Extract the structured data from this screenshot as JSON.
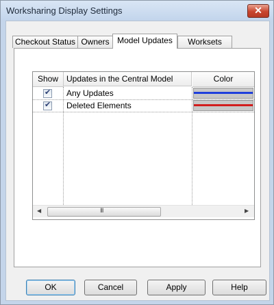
{
  "window": {
    "title": "Worksharing Display Settings",
    "close_glyph": "✕"
  },
  "tabs": [
    {
      "label": "Checkout Status",
      "active": false
    },
    {
      "label": "Owners",
      "active": false
    },
    {
      "label": "Model Updates",
      "active": true
    },
    {
      "label": "Worksets",
      "active": false
    }
  ],
  "grid": {
    "columns": {
      "show": "Show",
      "updates": "Updates in the Central Model",
      "color": "Color"
    },
    "rows": [
      {
        "checked": true,
        "label": "Any Updates",
        "color": "#1f3fdc"
      },
      {
        "checked": true,
        "label": "Deleted Elements",
        "color": "#d21d1d"
      }
    ]
  },
  "scrollbar": {
    "left_icon": "◀",
    "right_icon": "▶",
    "grip": "III"
  },
  "buttons": {
    "ok": "OK",
    "cancel": "Cancel",
    "apply": "Apply",
    "help": "Help"
  }
}
